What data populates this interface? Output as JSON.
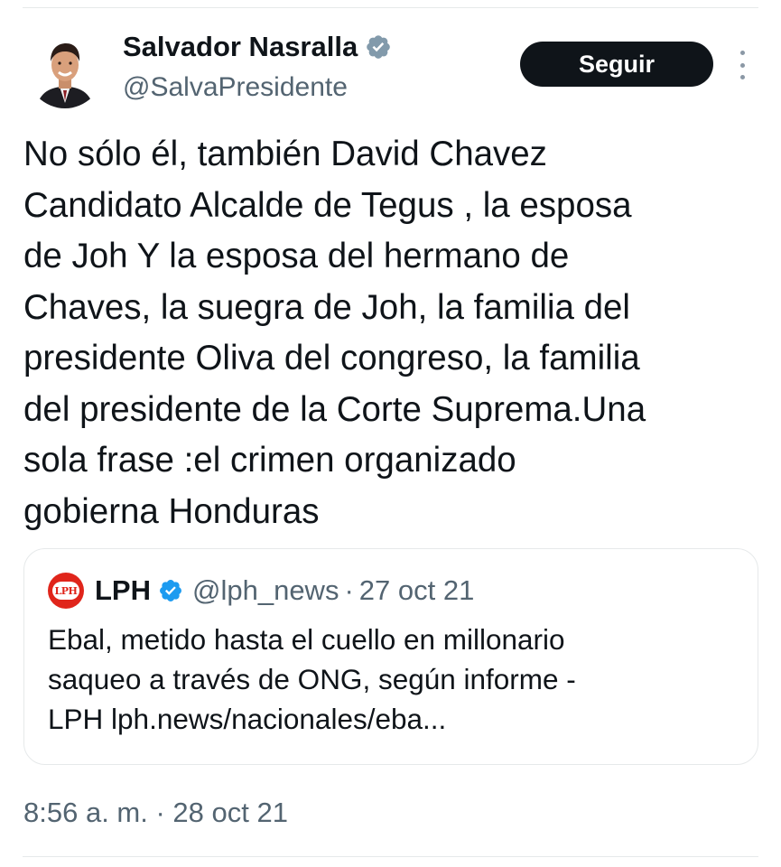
{
  "tweet": {
    "author_name": "Salvador Nasralla",
    "author_handle": "@SalvaPresidente",
    "follow_label": "Seguir",
    "text_lines": [
      "No sólo él, también David Chavez",
      "Candidato Alcalde de Tegus , la esposa",
      "de Joh Y la esposa del hermano de",
      "Chaves, la suegra de Joh, la familia del",
      "presidente Oliva del congreso, la familia",
      "del presidente de la Corte Suprema.Una",
      "sola frase :el crimen organizado",
      "gobierna Honduras"
    ],
    "timestamp": "8:56 a. m. · 28 oct 21"
  },
  "quote": {
    "avatar_text": "LPH",
    "name": "LPH",
    "handle": "@lph_news",
    "separator": "·",
    "date": "27 oct 21",
    "text_lines": [
      "Ebal, metido hasta el cuello en millonario",
      "saqueo a través de ONG, según informe -",
      "LPH lph.news/nacionales/eba..."
    ]
  },
  "icons": {
    "verified": "verified-badge-icon",
    "more": "more-options-icon",
    "avatar": "avatar-photo"
  },
  "colors": {
    "verified_badge": "#829aab",
    "follow_button_bg": "#0f1419",
    "secondary_text": "#536471",
    "lph_brand": "#e0251b"
  }
}
